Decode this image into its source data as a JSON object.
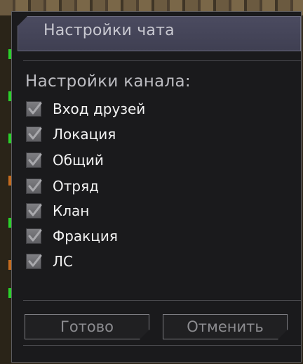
{
  "dialog": {
    "title": "Настройки чата",
    "section_title": "Настройки канала:"
  },
  "options": [
    {
      "label": "Вход друзей",
      "checked": true
    },
    {
      "label": "Локация",
      "checked": true
    },
    {
      "label": "Общий",
      "checked": true
    },
    {
      "label": "Отряд",
      "checked": true
    },
    {
      "label": "Клан",
      "checked": true
    },
    {
      "label": "Фракция",
      "checked": true
    },
    {
      "label": "ЛС",
      "checked": true
    }
  ],
  "buttons": {
    "confirm_label": "Готово",
    "cancel_label": "Отменить"
  },
  "colors": {
    "panel_bg": "#1a1a1c",
    "title_bar": "#44445a",
    "checkbox": "#6e6e72",
    "text": "#f2f2f2",
    "button_text": "#8c8c90"
  }
}
